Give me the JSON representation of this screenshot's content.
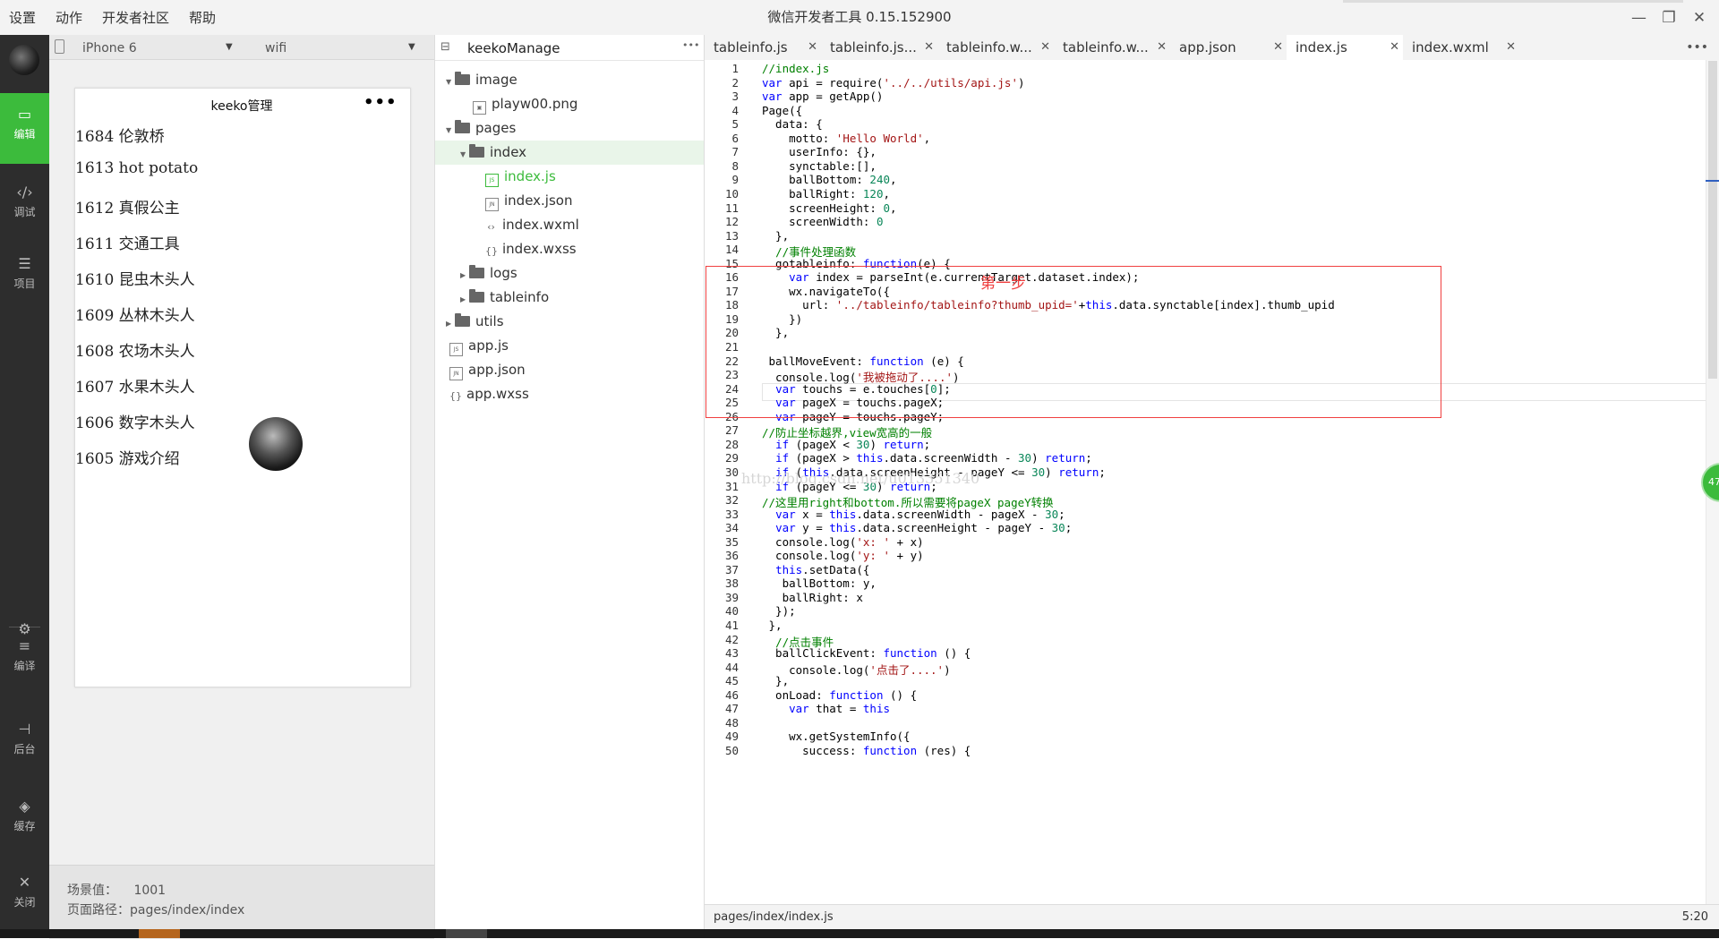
{
  "titlebar": {
    "menu": [
      "设置",
      "动作",
      "开发者社区",
      "帮助"
    ],
    "title": "微信开发者工具 0.15.152900"
  },
  "sidebar": {
    "items": [
      {
        "label": "编辑",
        "icon": "edit-icon"
      },
      {
        "label": "调试",
        "icon": "code-icon"
      },
      {
        "label": "项目",
        "icon": "menu-icon"
      },
      {
        "label": "编译",
        "icon": "compile-icon"
      },
      {
        "label": "后台",
        "icon": "background-icon"
      },
      {
        "label": "缓存",
        "icon": "layers-icon"
      },
      {
        "label": "关闭",
        "icon": "close-icon"
      }
    ]
  },
  "simulator": {
    "device": "iPhone 6",
    "network": "wifi",
    "page_title": "keeko管理",
    "menu_dots": "•••",
    "rows": [
      "1684 伦敦桥",
      "1613 hot potato",
      "1612 真假公主",
      "1611 交通工具",
      "1610 昆虫木头人",
      "1609 丛林木头人",
      "1608 农场木头人",
      "1607 水果木头人",
      "1606 数字木头人",
      "1605 游戏介绍"
    ],
    "scene_label": "场景值：",
    "scene_value": "1001",
    "path_label": "页面路径：",
    "path_value": "pages/index/index"
  },
  "filetree": {
    "project": "keekoManage",
    "more": "•••",
    "items": [
      {
        "label": "image",
        "kind": "folder",
        "open": true
      },
      {
        "label": "playw00.png",
        "kind": "image"
      },
      {
        "label": "pages",
        "kind": "folder",
        "open": true
      },
      {
        "label": "index",
        "kind": "folder",
        "open": true
      },
      {
        "label": "index.js",
        "kind": "js",
        "badge": "JS"
      },
      {
        "label": "index.json",
        "kind": "json",
        "badge": "JN"
      },
      {
        "label": "index.wxml",
        "kind": "wxml",
        "badge": "‹›"
      },
      {
        "label": "index.wxss",
        "kind": "wxss",
        "badge": "{}"
      },
      {
        "label": "logs",
        "kind": "folder",
        "open": false
      },
      {
        "label": "tableinfo",
        "kind": "folder",
        "open": false
      },
      {
        "label": "utils",
        "kind": "folder",
        "open": false
      },
      {
        "label": "app.js",
        "kind": "js",
        "badge": "JS"
      },
      {
        "label": "app.json",
        "kind": "json",
        "badge": "JN"
      },
      {
        "label": "app.wxss",
        "kind": "wxss",
        "badge": "{}"
      }
    ]
  },
  "editor": {
    "tabs": [
      "tableinfo.js",
      "tableinfo.js...",
      "tableinfo.w...",
      "tableinfo.w...",
      "app.json",
      "index.js",
      "index.wxml"
    ],
    "active_tab": "index.js",
    "close_glyph": "✕",
    "more": "•••",
    "annotation": "第一步",
    "watermark": "http://blog.csdn.net/u013351340",
    "status_path": "pages/index/index.js",
    "status_pos": "5:20",
    "badge": "47",
    "code_lines": [
      "//index.js",
      "var api = require('../../utils/api.js')",
      "var app = getApp()",
      "Page({",
      "  data: {",
      "    motto: 'Hello World',",
      "    userInfo: {},",
      "    synctable:[],",
      "    ballBottom: 240,",
      "    ballRight: 120,",
      "    screenHeight: 0,",
      "    screenWidth: 0",
      "  },",
      "  //事件处理函数",
      "  gotableinfo: function(e) {",
      "    var index = parseInt(e.currentTarget.dataset.index);",
      "    wx.navigateTo({",
      "      url: '../tableinfo/tableinfo?thumb_upid='+this.data.synctable[index].thumb_upid",
      "    })",
      "  },",
      "",
      " ballMoveEvent: function (e) {",
      "  console.log('我被拖动了....')",
      "  var touchs = e.touches[0];",
      "  var pageX = touchs.pageX;",
      "  var pageY = touchs.pageY;",
      "//防止坐标越界,view宽高的一般",
      "  if (pageX < 30) return;",
      "  if (pageX > this.data.screenWidth - 30) return;",
      "  if (this.data.screenHeight - pageY <= 30) return;",
      "  if (pageY <= 30) return;",
      "//这里用right和bottom.所以需要将pageX pageY转换",
      "  var x = this.data.screenWidth - pageX - 30;",
      "  var y = this.data.screenHeight - pageY - 30;",
      "  console.log('x: ' + x)",
      "  console.log('y: ' + y)",
      "  this.setData({",
      "   ballBottom: y,",
      "   ballRight: x",
      "  });",
      " },",
      "  //点击事件",
      "  ballClickEvent: function () {",
      "    console.log('点击了....')",
      "  },",
      "  onLoad: function () {",
      "    var that = this",
      "",
      "    wx.getSystemInfo({",
      "      success: function (res) {"
    ]
  },
  "colors": {
    "accent": "#3cbb3c",
    "annotation": "#f04040",
    "keyword": "#0000ff",
    "string": "#a31515",
    "number": "#098658",
    "comment": "#008000"
  }
}
